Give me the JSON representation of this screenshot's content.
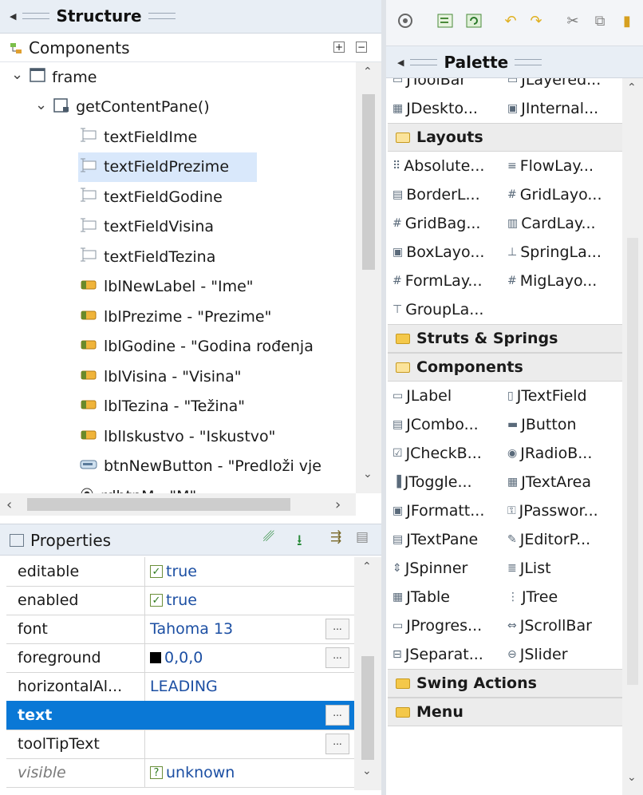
{
  "structure": {
    "tab_title": "Structure",
    "components_title": "Components",
    "tree": [
      {
        "label": "frame",
        "depth": 0,
        "expander": "⌄",
        "icon": "frame-icon"
      },
      {
        "label": "getContentPane()",
        "depth": 1,
        "expander": "⌄",
        "icon": "panel-icon"
      },
      {
        "label": "textFieldIme",
        "depth": 2,
        "icon": "textfield-icon"
      },
      {
        "label": "textFieldPrezime",
        "depth": 2,
        "icon": "textfield-icon",
        "selected": true
      },
      {
        "label": "textFieldGodine",
        "depth": 2,
        "icon": "textfield-icon"
      },
      {
        "label": "textFieldVisina",
        "depth": 2,
        "icon": "textfield-icon"
      },
      {
        "label": "textFieldTezina",
        "depth": 2,
        "icon": "textfield-icon"
      },
      {
        "label": "lblNewLabel - \"Ime\"",
        "depth": 2,
        "icon": "label-icon"
      },
      {
        "label": "lblPrezime - \"Prezime\"",
        "depth": 2,
        "icon": "label-icon"
      },
      {
        "label": "lblGodine - \"Godina rođenja",
        "depth": 2,
        "icon": "label-icon"
      },
      {
        "label": "lblVisina - \"Visina\"",
        "depth": 2,
        "icon": "label-icon"
      },
      {
        "label": "lblTezina - \"Težina\"",
        "depth": 2,
        "icon": "label-icon"
      },
      {
        "label": "lblIskustvo - \"Iskustvo\"",
        "depth": 2,
        "icon": "label-icon"
      },
      {
        "label": "btnNewButton - \"Predloži vje",
        "depth": 2,
        "icon": "button-icon"
      },
      {
        "label": "rdbtnM - \"M\"",
        "depth": 2,
        "icon": "radio-icon"
      }
    ]
  },
  "properties": {
    "title": "Properties",
    "rows": [
      {
        "name": "editable",
        "value": "true",
        "checkbox": true
      },
      {
        "name": "enabled",
        "value": "true",
        "checkbox": true
      },
      {
        "name": "font",
        "value": "Tahoma 13",
        "button": true
      },
      {
        "name": "foreground",
        "value": "0,0,0",
        "swatch": "#000000",
        "button": true
      },
      {
        "name": "horizontalAl...",
        "value": "LEADING"
      },
      {
        "name": "text",
        "value": "",
        "button": true,
        "selected": true
      },
      {
        "name": "toolTipText",
        "value": "",
        "button": true
      },
      {
        "name": "visible",
        "value": "unknown",
        "unknown": true,
        "italic": true
      }
    ],
    "ellipsis": "..."
  },
  "palette": {
    "tab_title": "Palette",
    "partial_top": [
      "JToolBar",
      "JLayered..."
    ],
    "top_items": [
      [
        "JDeskto...",
        "JInternal..."
      ]
    ],
    "categories": [
      {
        "name": "Layouts",
        "open": true,
        "items": [
          [
            "Absolute...",
            "FlowLay..."
          ],
          [
            "BorderL...",
            "GridLayo..."
          ],
          [
            "GridBag...",
            "CardLay..."
          ],
          [
            "BoxLayo...",
            "SpringLa..."
          ],
          [
            "FormLay...",
            "MigLayo..."
          ],
          [
            "GroupLa...",
            null
          ]
        ]
      },
      {
        "name": "Struts & Springs",
        "open": false,
        "items": []
      },
      {
        "name": "Components",
        "open": true,
        "items": [
          [
            "JLabel",
            "JTextField"
          ],
          [
            "JCombo...",
            "JButton"
          ],
          [
            "JCheckB...",
            "JRadioB..."
          ],
          [
            "JToggle...",
            "JTextArea"
          ],
          [
            "JFormatt...",
            "JPasswor..."
          ],
          [
            "JTextPane",
            "JEditorP..."
          ],
          [
            "JSpinner",
            "JList"
          ],
          [
            "JTable",
            "JTree"
          ],
          [
            "JProgres...",
            "JScrollBar"
          ],
          [
            "JSeparat...",
            "JSlider"
          ]
        ]
      },
      {
        "name": "Swing Actions",
        "open": false,
        "items": []
      },
      {
        "name": "Menu",
        "open": false,
        "items": []
      }
    ]
  },
  "colors": {
    "selection": "#d9e8fb",
    "selected_property": "#0a78d6",
    "value_text": "#1c4fa3",
    "panel_header": "#e8eef5"
  }
}
